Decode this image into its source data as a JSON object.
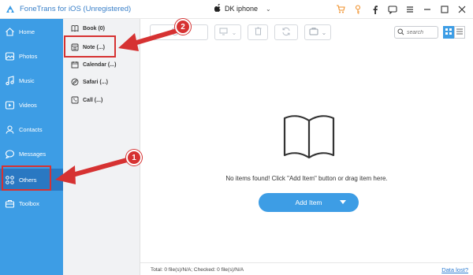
{
  "app": {
    "title": "FoneTrans for iOS (Unregistered)",
    "device_name": "DK iphone"
  },
  "titlebar_icons": [
    "cart-icon",
    "key-icon",
    "facebook-icon",
    "chat-icon",
    "menu-icon",
    "minimize-icon",
    "maximize-icon",
    "close-icon"
  ],
  "sidebar": {
    "items": [
      {
        "label": "Home",
        "icon": "home-icon"
      },
      {
        "label": "Photos",
        "icon": "photos-icon"
      },
      {
        "label": "Music",
        "icon": "music-icon"
      },
      {
        "label": "Videos",
        "icon": "videos-icon"
      },
      {
        "label": "Contacts",
        "icon": "contacts-icon"
      },
      {
        "label": "Messages",
        "icon": "messages-icon"
      },
      {
        "label": "Others",
        "icon": "others-icon"
      },
      {
        "label": "Toolbox",
        "icon": "toolbox-icon"
      }
    ],
    "active": "Others"
  },
  "subpanel": {
    "items": [
      {
        "label": "Book (0)",
        "icon": "book-icon"
      },
      {
        "label": "Note (...)",
        "icon": "note-icon"
      },
      {
        "label": "Calendar (...)",
        "icon": "calendar-icon"
      },
      {
        "label": "Safari (...)",
        "icon": "safari-icon"
      },
      {
        "label": "Call (...)",
        "icon": "call-icon"
      }
    ],
    "active": "Note (...)"
  },
  "search": {
    "placeholder": "search"
  },
  "main": {
    "empty_message": "No items found! Click \"Add Item\" button or drag item here.",
    "add_button": "Add Item"
  },
  "status": {
    "summary": "Total: 0 file(s)/N/A; Checked: 0 file(s)/N/A",
    "data_lost": "Data lost?"
  },
  "annotations": {
    "badge_1": "1",
    "badge_2": "2"
  },
  "colors": {
    "sidebar": "#3d9de5",
    "sidebar_active": "#2a78c2",
    "accent": "#3d9de5",
    "highlight": "#d63232"
  }
}
